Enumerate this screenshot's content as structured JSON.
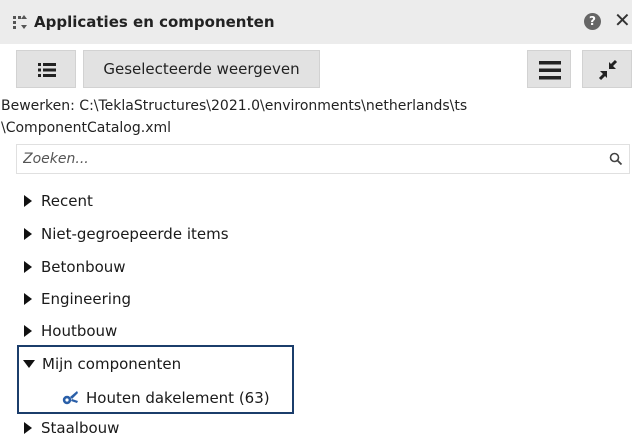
{
  "panel": {
    "title": "Applicaties en componenten"
  },
  "toolbar": {
    "show_selected_label": "Geselecteerde weergeven"
  },
  "edit_path": {
    "line1": "Bewerken:  C:\\TeklaStructures\\2021.0\\environments\\netherlands\\ts",
    "line2": "\\ComponentCatalog.xml"
  },
  "search": {
    "placeholder": "Zoeken..."
  },
  "tree": {
    "items": [
      {
        "label": "Recent",
        "expanded": false
      },
      {
        "label": "Niet-gegroepeerde items",
        "expanded": false
      },
      {
        "label": "Betonbouw",
        "expanded": false
      },
      {
        "label": "Engineering",
        "expanded": false
      },
      {
        "label": "Houtbouw",
        "expanded": false
      },
      {
        "label": "Mijn componenten",
        "expanded": true
      },
      {
        "label": "Staalbouw",
        "expanded": false
      }
    ],
    "child": {
      "label": "Houten dakelement (63)",
      "icon": "component-icon"
    }
  },
  "colors": {
    "highlight_border": "#1b3d6b",
    "component_icon": "#2a5fa8"
  }
}
